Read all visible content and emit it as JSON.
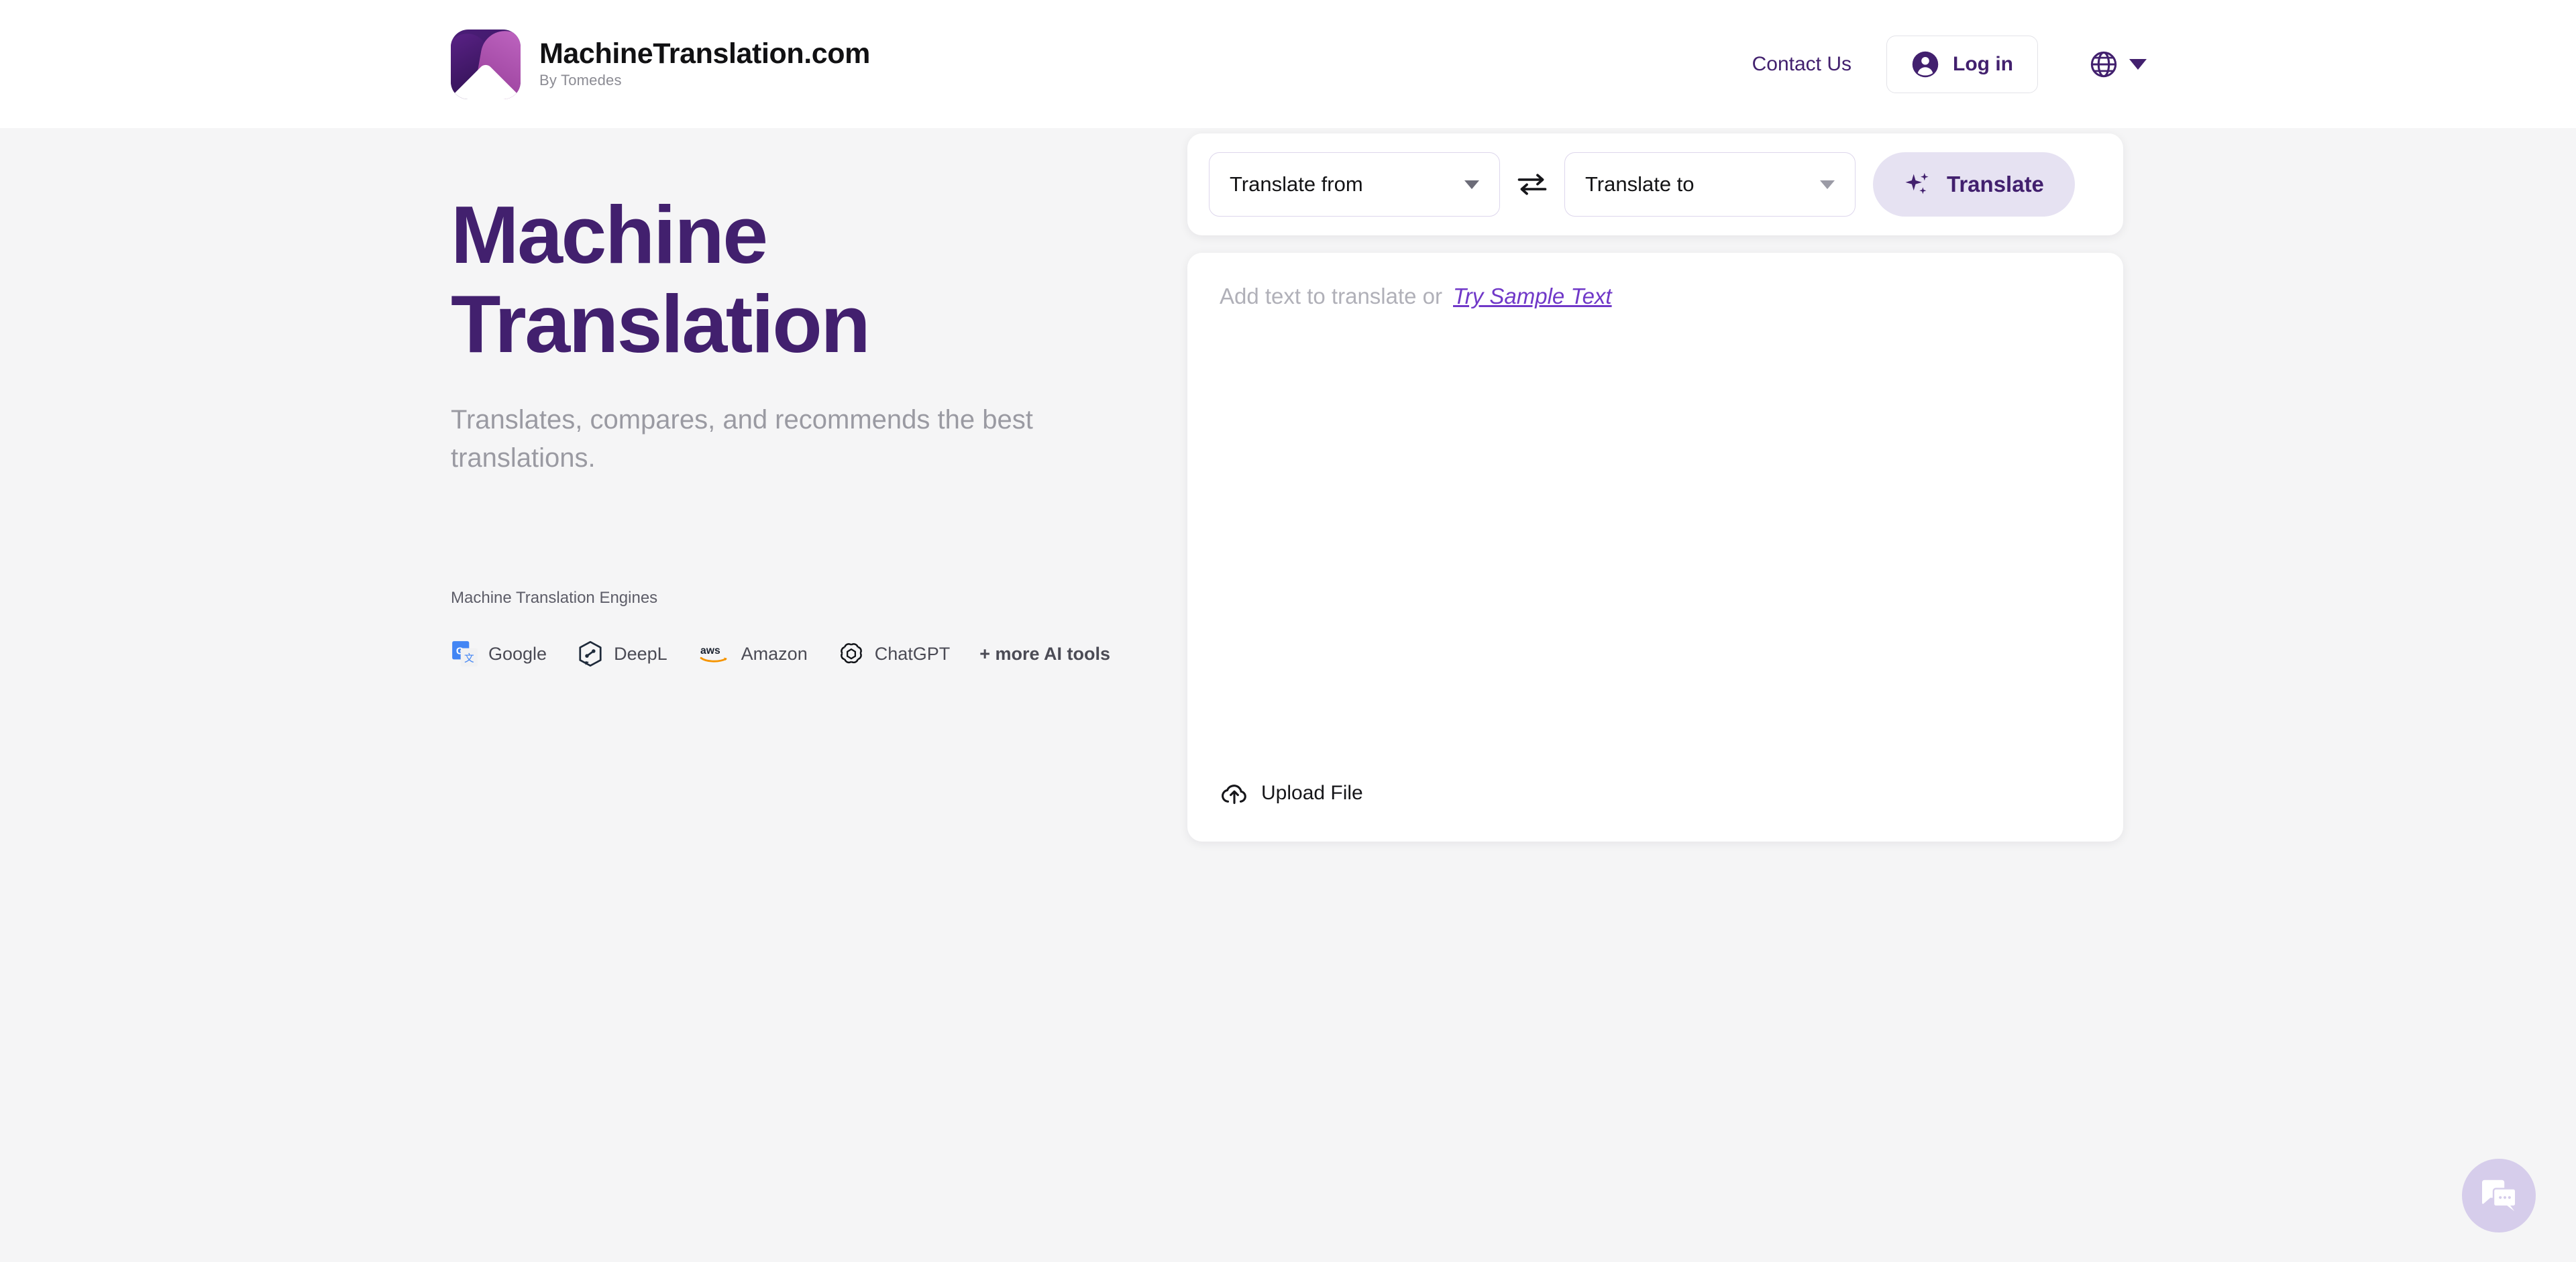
{
  "header": {
    "brand": {
      "logo_icon": "machinetranslation-logo-icon",
      "title": "MachineTranslation.com",
      "subtitle": "By Tomedes"
    },
    "contact_label": "Contact Us",
    "login": {
      "label": "Log in",
      "icon": "user-circle-icon"
    },
    "language_switcher": {
      "icon": "globe-icon",
      "caret_icon": "chevron-down-icon"
    }
  },
  "hero": {
    "title_line1": "Machine",
    "title_line2": "Translation",
    "subtitle": "Translates, compares, and recommends the best translations.",
    "engines_label": "Machine Translation Engines",
    "engines": [
      {
        "name": "Google",
        "icon": "google-translate-icon"
      },
      {
        "name": "DeepL",
        "icon": "deepl-icon"
      },
      {
        "name": "Amazon",
        "icon": "aws-icon"
      },
      {
        "name": "ChatGPT",
        "icon": "openai-icon"
      }
    ],
    "more_tools_label": "+ more AI tools"
  },
  "translator": {
    "source_select": {
      "value": "Translate from",
      "caret_icon": "chevron-down-icon"
    },
    "swap": {
      "icon": "swap-arrows-icon"
    },
    "target_select": {
      "value": "Translate to",
      "caret_icon": "chevron-down-icon"
    },
    "translate_button": {
      "label": "Translate",
      "icon": "sparkle-icon"
    },
    "input": {
      "placeholder_text": "Add text to translate or",
      "sample_link": "Try Sample Text",
      "value": ""
    },
    "upload": {
      "label": "Upload File",
      "icon": "cloud-upload-icon"
    }
  },
  "chat_widget": {
    "icon": "chat-bubbles-icon"
  },
  "colors": {
    "brand_purple": "#42206e",
    "accent_violet": "#7038c8",
    "button_lavender": "#e6e2f2",
    "page_bg": "#f5f5f6",
    "header_bg": "#ffffff",
    "muted_text": "#9a9aa2"
  }
}
